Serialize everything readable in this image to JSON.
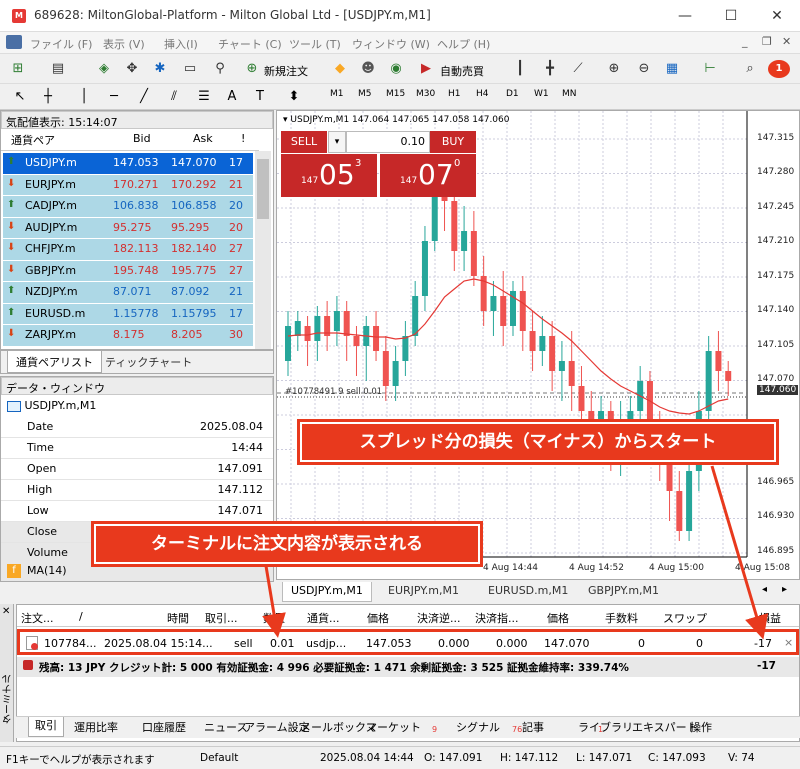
{
  "window": {
    "id": "689628",
    "title": "689628: MiltonGlobal-Platform - Milton Global Ltd - [USDJPY.m,M1]",
    "app_icon": "M"
  },
  "menu": [
    "ファイル (F)",
    "表示 (V)",
    "挿入(I)",
    "チャート (C)",
    "ツール (T)",
    "ウィンドウ (W)",
    "ヘルプ (H)"
  ],
  "toolbar": {
    "new_order": "新規注文",
    "auto_trade": "自動売買",
    "notify_count": "1"
  },
  "timeframes": [
    "M1",
    "M5",
    "M15",
    "M30",
    "H1",
    "H4",
    "D1",
    "W1",
    "MN"
  ],
  "market_watch": {
    "title": "気配値表示: 15:14:07",
    "headers": [
      "通貨ペア",
      "Bid",
      "Ask",
      "!"
    ],
    "rows": [
      {
        "symbol": "USDJPY.m",
        "bid": "147.053",
        "ask": "147.070",
        "spread": "17",
        "dir": "up"
      },
      {
        "symbol": "EURJPY.m",
        "bid": "170.271",
        "ask": "170.292",
        "spread": "21",
        "dir": "down"
      },
      {
        "symbol": "CADJPY.m",
        "bid": "106.838",
        "ask": "106.858",
        "spread": "20",
        "dir": "up"
      },
      {
        "symbol": "AUDJPY.m",
        "bid": "95.275",
        "ask": "95.295",
        "spread": "20",
        "dir": "down"
      },
      {
        "symbol": "CHFJPY.m",
        "bid": "182.113",
        "ask": "182.140",
        "spread": "27",
        "dir": "down"
      },
      {
        "symbol": "GBPJPY.m",
        "bid": "195.748",
        "ask": "195.775",
        "spread": "27",
        "dir": "down"
      },
      {
        "symbol": "NZDJPY.m",
        "bid": "87.071",
        "ask": "87.092",
        "spread": "21",
        "dir": "up"
      },
      {
        "symbol": "EURUSD.m",
        "bid": "1.15778",
        "ask": "1.15795",
        "spread": "17",
        "dir": "up"
      },
      {
        "symbol": "ZARJPY.m",
        "bid": "8.175",
        "ask": "8.205",
        "span": "30",
        "spread": "30",
        "dir": "down"
      }
    ],
    "tabs": [
      "通貨ペアリスト",
      "ティックチャート"
    ]
  },
  "data_window": {
    "title": "データ・ウィンドウ",
    "symbol": "USDJPY.m,M1",
    "rows": [
      [
        "Date",
        "2025.08.04"
      ],
      [
        "Time",
        "14:44"
      ],
      [
        "Open",
        "147.091"
      ],
      [
        "High",
        "147.112"
      ],
      [
        "Low",
        "147.071"
      ],
      [
        "Close",
        ""
      ],
      [
        "Volume",
        ""
      ]
    ],
    "indicator": "MA(14)"
  },
  "chart": {
    "header": "USDJPY.m,M1  147.064 147.065 147.058 147.060",
    "sell": "SELL",
    "buy": "BUY",
    "lot": "0.10",
    "sell_price_small": "147",
    "sell_price_big": "05",
    "sell_price_sup": "3",
    "buy_price_small": "147",
    "buy_price_big": "07",
    "buy_price_sup": "0",
    "order_line": "#10778491 9 sell 0.01",
    "price_labels": [
      "147.315",
      "147.280",
      "147.245",
      "147.210",
      "147.175",
      "147.140",
      "147.105",
      "147.070",
      "147.060",
      "146.965",
      "146.930",
      "146.895"
    ],
    "time_labels": [
      "4 Aug 14:44",
      "4 Aug 14:52",
      "4 Aug 15:00",
      "4 Aug 15:08"
    ],
    "tabs": [
      "USDJPY.m,M1",
      "EURJPY.m,M1",
      "EURUSD.m,M1",
      "GBPJPY.m,M1"
    ]
  },
  "callouts": {
    "spread": "スプレッド分の損失（マイナス）からスタート",
    "terminal": "ターミナルに注文内容が表示される"
  },
  "terminal": {
    "headers": [
      "注文...",
      "/",
      "時間",
      "取引...",
      "数量",
      "通貨...",
      "価格",
      "決済逆...",
      "決済指...",
      "価格",
      "手数料",
      "スワップ",
      "損益"
    ],
    "order": {
      "id": "107784...",
      "time": "2025.08.04 15:14...",
      "type": "sell",
      "volume": "0.01",
      "symbol": "usdjp...",
      "price": "147.053",
      "sl": "0.000",
      "tp": "0.000",
      "cur_price": "147.070",
      "commission": "0",
      "swap": "0",
      "profit": "-17",
      "close": "×"
    },
    "balance": "残高: 13 JPY  クレジット計: 5 000  有効証拠金: 4 996  必要証拠金: 1 471  余剰証拠金: 3 525  証拠金維持率: 339.74%",
    "balance_profit": "-17",
    "side_label": "ターミナル",
    "tabs": [
      "取引",
      "運用比率",
      "口座履歴",
      "ニュース",
      "アラーム設定",
      "メールボックス",
      "マーケット",
      "シグナル",
      "記事",
      "ライブラリ",
      "エキスパート",
      "操作"
    ],
    "tab_badges": {
      "mail": "9",
      "market": "76",
      "articles": "1"
    }
  },
  "status": {
    "help": "F1キーでヘルプが表示されます",
    "profile": "Default",
    "datetime": "2025.08.04 14:44",
    "open": "O: 147.091",
    "high": "H: 147.112",
    "low": "L: 147.071",
    "close": "C: 147.093",
    "volume": "V: 74"
  },
  "colors": {
    "up": "#26a69a",
    "down": "#ef5350",
    "sell_btn": "#c62828",
    "callout": "#e8391d",
    "ma": "#e53935"
  }
}
